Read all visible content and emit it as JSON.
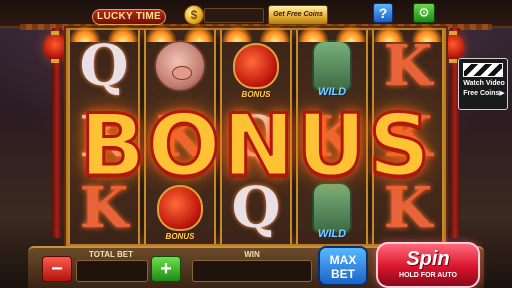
{
  "top_bar": {
    "lucky_label": "LUCKY TIME",
    "coin_icon": "coin-icon",
    "coin_symbol": "$",
    "free_coins_label": "Get Free Coins",
    "help_label": "?",
    "settings_icon": "gear-icon",
    "settings_glyph": "⚙"
  },
  "reels": [
    {
      "symbols": [
        {
          "type": "letter",
          "text": "Q",
          "color": "white"
        },
        {
          "type": "letter",
          "text": "K",
          "color": "white"
        },
        {
          "type": "letter",
          "text": "K",
          "color": "red"
        }
      ]
    },
    {
      "symbols": [
        {
          "type": "pig"
        },
        {
          "type": "letter",
          "text": "K",
          "color": "red"
        },
        {
          "type": "bag",
          "text": "BONUS"
        }
      ]
    },
    {
      "symbols": [
        {
          "type": "bag",
          "text": "BONUS"
        },
        {
          "type": "letter",
          "text": "Q",
          "color": "white"
        },
        {
          "type": "letter",
          "text": "Q",
          "color": "white"
        }
      ]
    },
    {
      "symbols": [
        {
          "type": "hand",
          "text": "WILD"
        },
        {
          "type": "letter",
          "text": "K",
          "color": "red"
        },
        {
          "type": "hand",
          "text": "WILD"
        }
      ]
    },
    {
      "symbols": [
        {
          "type": "letter",
          "text": "K",
          "color": "red"
        },
        {
          "type": "letter",
          "text": "K",
          "color": "red"
        },
        {
          "type": "letter",
          "text": "K",
          "color": "red"
        }
      ]
    }
  ],
  "banner": {
    "text": "BONUS"
  },
  "watch_video": {
    "line1": "Watch Video",
    "line2": "Free Coins▶"
  },
  "bottom_bar": {
    "minus_label": "−",
    "plus_label": "+",
    "total_bet_label": "TOTAL BET",
    "total_bet_value": "",
    "win_label": "WIN",
    "win_value": "",
    "max_bet_line1": "MAX",
    "max_bet_line2": "BET",
    "spin_label": "Spin",
    "spin_sub": "HOLD FOR AUTO"
  },
  "colors": {
    "banner": "#ffc235",
    "banner_stroke": "#b0180c",
    "spin": "#d8142c",
    "max_bet": "#1c63c8",
    "plus": "#1e8a16",
    "minus": "#b0140c"
  }
}
